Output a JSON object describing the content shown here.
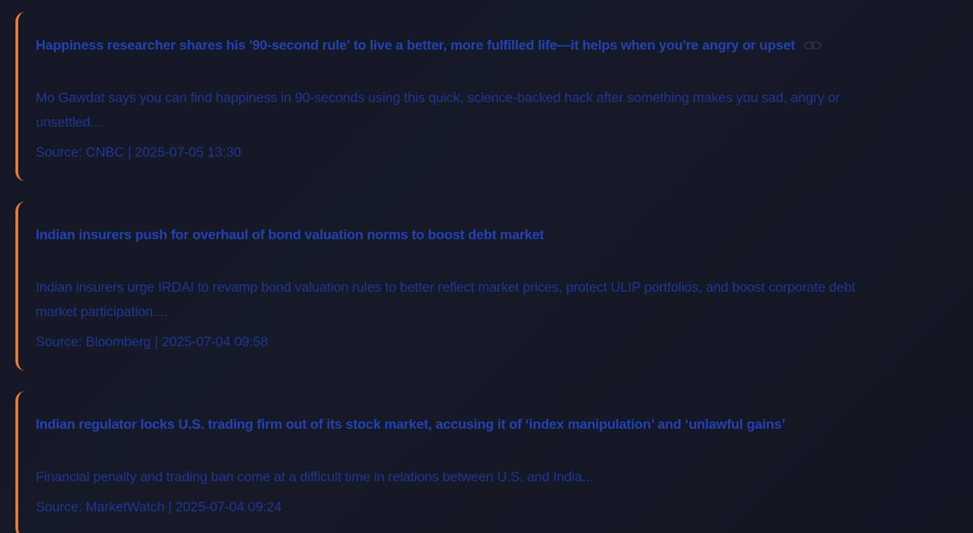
{
  "articles": [
    {
      "title": "Happiness researcher shares his '90-second rule' to live a better, more fulfilled life—it helps when you're angry or upset",
      "summary": "Mo Gawdat says you can find happiness in 90-seconds using this quick, science-backed hack after something makes you sad, angry or unsettled....",
      "meta": "Source: CNBC | 2025-07-05 13:30",
      "has_link_icon": true
    },
    {
      "title": "Indian insurers push for overhaul of bond valuation norms to boost debt market",
      "summary": "Indian insurers urge IRDAI to revamp bond valuation rules to better reflect market prices, protect ULIP portfolios, and boost corporate debt market participation....",
      "meta": "Source: Bloomberg | 2025-07-04 09:58",
      "has_link_icon": false
    },
    {
      "title": "Indian regulator locks U.S. trading firm out of its stock market, accusing it of ‘index manipulation’ and ‘unlawful gains’",
      "summary": "Financial penalty and trading ban come at a difficult time in relations between U.S. and India...",
      "meta": "Source: MarketWatch | 2025-07-04 09:24",
      "has_link_icon": false
    }
  ],
  "colors": {
    "accent_border": "#f07a34",
    "title": "#2241b4",
    "body_text": "#1f3694",
    "background": "#131824"
  },
  "icons": {
    "link": "link-icon"
  }
}
